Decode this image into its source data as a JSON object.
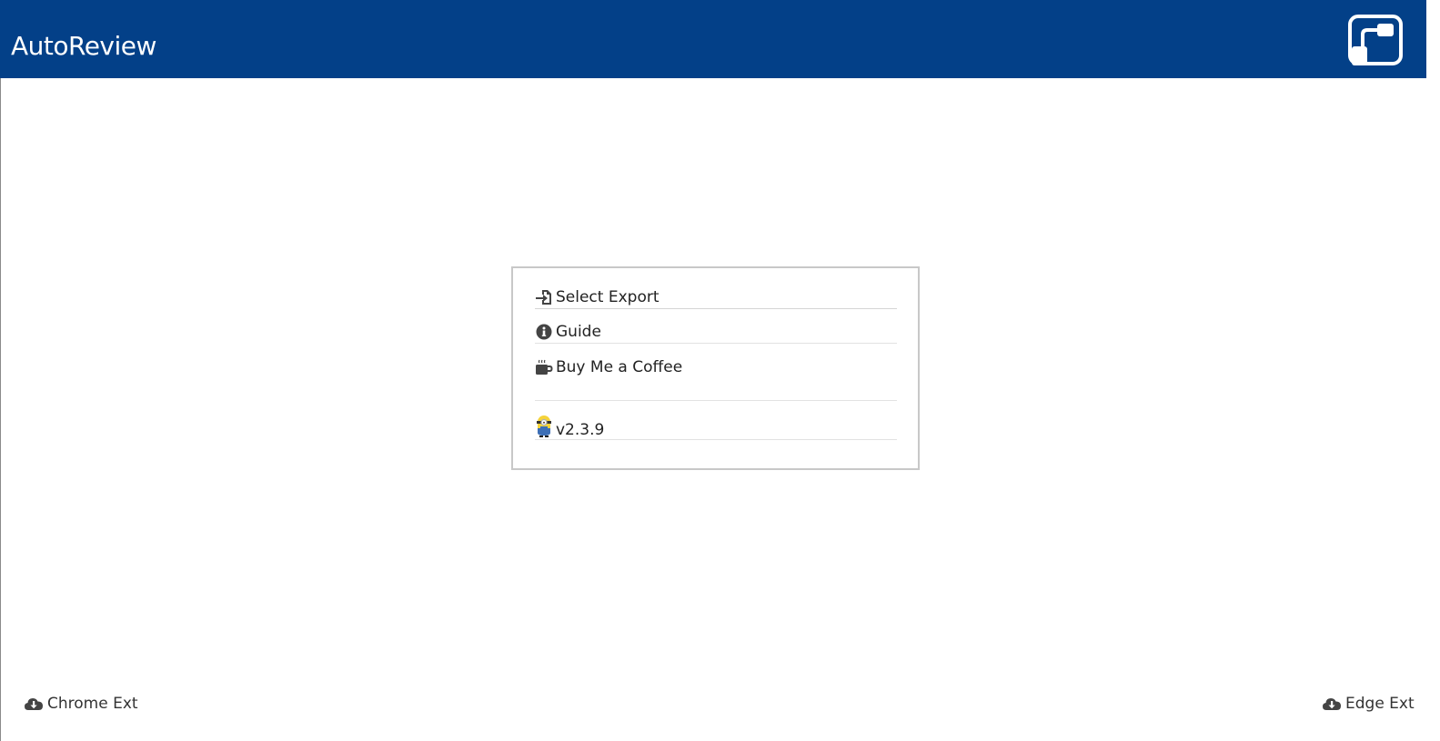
{
  "app": {
    "title": "AutoReview",
    "header_color": "#034088"
  },
  "menu": {
    "items": [
      {
        "label": "Select Export",
        "icon": "file-import-icon"
      },
      {
        "label": "Guide",
        "icon": "info-circle-icon"
      },
      {
        "label": "Buy Me a Coffee",
        "icon": "coffee-mug-icon"
      }
    ],
    "version": {
      "label": "v2.3.9",
      "icon": "minion-icon"
    }
  },
  "footer": {
    "chrome_ext": {
      "label": "Chrome Ext",
      "icon": "cloud-download-icon"
    },
    "edge_ext": {
      "label": "Edge Ext",
      "icon": "cloud-download-icon"
    }
  }
}
